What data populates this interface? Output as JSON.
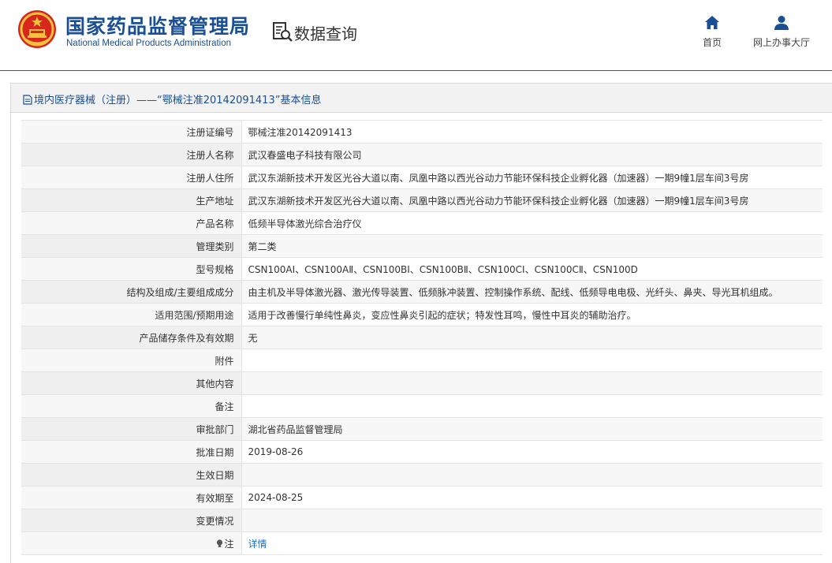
{
  "header": {
    "agency_cn": "国家药品监督管理局",
    "agency_en": "National Medical Products Administration",
    "query_title": "数据查询",
    "icons": {
      "emblem": "national-emblem-icon",
      "query": "document-search-icon"
    },
    "nav": [
      {
        "label": "首页",
        "icon": "home-icon"
      },
      {
        "label": "网上办事大厅",
        "icon": "user-icon"
      }
    ]
  },
  "panel": {
    "title": "境内医疗器械（注册）——“鄂械注准20142091413”基本信息",
    "title_icon": "document-icon"
  },
  "rows": [
    {
      "label": "注册证编号",
      "value": "鄂械注准20142091413"
    },
    {
      "label": "注册人名称",
      "value": "武汉春盛电子科技有限公司"
    },
    {
      "label": "注册人住所",
      "value": "武汉东湖新技术开发区光谷大道以南、凤凰中路以西光谷动力节能环保科技企业孵化器（加速器）一期9幢1层车间3号房"
    },
    {
      "label": "生产地址",
      "value": "武汉东湖新技术开发区光谷大道以南、凤凰中路以西光谷动力节能环保科技企业孵化器（加速器）一期9幢1层车间3号房"
    },
    {
      "label": "产品名称",
      "value": "低频半导体激光综合治疗仪"
    },
    {
      "label": "管理类别",
      "value": "第二类"
    },
    {
      "label": "型号规格",
      "value": "CSN100AⅠ、CSN100AⅡ、CSN100BⅠ、CSN100BⅡ、CSN100CⅠ、CSN100CⅡ、CSN100D"
    },
    {
      "label": "结构及组成/主要组成成分",
      "value": "由主机及半导体激光器、激光传导装置、低频脉冲装置、控制操作系统、配线、低频导电电极、光纤头、鼻夹、导光耳机组成。"
    },
    {
      "label": "适用范围/预期用途",
      "value": "适用于改善慢行单纯性鼻炎，变应性鼻炎引起的症状；特发性耳鸣，慢性中耳炎的辅助治疗。"
    },
    {
      "label": "产品储存条件及有效期",
      "value": "无"
    },
    {
      "label": "附件",
      "value": ""
    },
    {
      "label": "其他内容",
      "value": ""
    },
    {
      "label": "备注",
      "value": ""
    },
    {
      "label": "审批部门",
      "value": "湖北省药品监督管理局"
    },
    {
      "label": "批准日期",
      "value": "2019-08-26"
    },
    {
      "label": "生效日期",
      "value": ""
    },
    {
      "label": "有效期至",
      "value": "2024-08-25"
    },
    {
      "label": "变更情况",
      "value": ""
    }
  ],
  "note_row": {
    "label": "注",
    "icon": "lightbulb-icon",
    "link": "详情"
  },
  "colors": {
    "brand_blue": "#1a4f96",
    "link_blue": "#1e6fc1",
    "header_line": "#1565a8"
  }
}
